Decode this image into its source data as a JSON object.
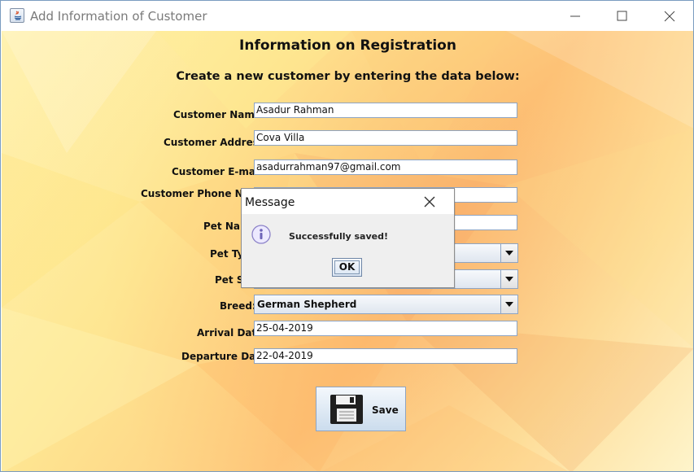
{
  "window": {
    "title": "Add Information of Customer",
    "controls": [
      "minimize",
      "maximize",
      "close"
    ]
  },
  "form": {
    "heading": "Information on Registration",
    "subheading": "Create a new customer by entering the data below:",
    "labels": {
      "customer_name": "Customer Name:",
      "customer_address": "Customer Address:",
      "customer_email": "Customer E-mail:",
      "customer_phone": "Customer Phone Num",
      "pet_name": "Pet Nam",
      "pet_type": "Pet Typ",
      "pet_sex": "Pet Se",
      "breed": "Breed:",
      "arrival_date": "Arrival Date:",
      "departure_date": "Departure Date:"
    },
    "values": {
      "customer_name": "Asadur Rahman",
      "customer_address": "Cova Villa",
      "customer_email": "asadurrahman97@gmail.com",
      "customer_phone": "",
      "pet_name": "",
      "pet_type": "",
      "pet_sex": "",
      "breed": "German Shepherd",
      "arrival_date": "25-04-2019",
      "departure_date": "22-04-2019"
    },
    "save_label": "Save"
  },
  "dialog": {
    "title": "Message",
    "message": "Successfully saved!",
    "ok_label": "OK"
  },
  "icons": {
    "java": "java-icon",
    "minimize": "minimize-icon",
    "maximize": "maximize-icon",
    "close": "close-icon",
    "dropdown": "chevron-down-icon",
    "save": "floppy-disk-icon",
    "info": "info-icon"
  },
  "colors": {
    "accent_border": "#8ea4c2",
    "info_icon": "#7468b8"
  }
}
